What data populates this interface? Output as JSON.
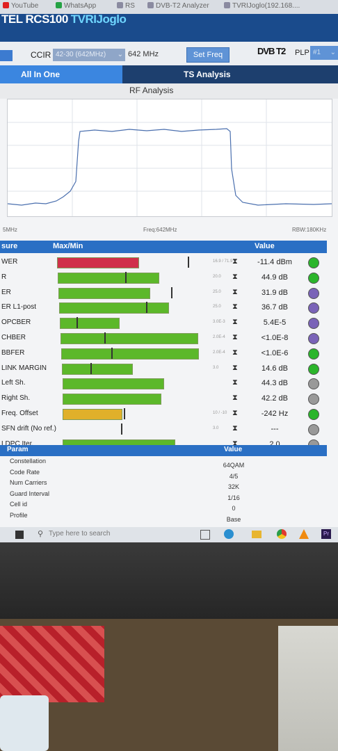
{
  "browser_tabs": [
    {
      "label": "YouTube",
      "color": "#e02020"
    },
    {
      "label": "WhatsApp",
      "color": "#25a244"
    },
    {
      "label": "RS",
      "color": "#8a8aa0"
    },
    {
      "label": "DVB-T2 Analyzer",
      "color": "#8a8aa0"
    },
    {
      "label": "TVRIJoglo(192.168....",
      "color": "#8a8aa0"
    }
  ],
  "app": {
    "brand": "TEL RCS100",
    "site": "TVRIJoglo",
    "ccir_label": "CCIR",
    "channel_value": "42-30 (642MHz)",
    "freq_text": "642 MHz",
    "set_freq": "Set Freq",
    "standard": "DVB T2",
    "plp_label": "PLP",
    "plp_value": "#1",
    "tab_allinone": "All In One",
    "tab_ts": "TS Analysis",
    "section_rf": "RF Analysis",
    "axis_center": "Freq:642MHz",
    "axis_left": "5MHz",
    "rbw": "RBW:180KHz"
  },
  "table": {
    "col_measure": "sure",
    "col_maxmin": "Max/Min",
    "col_value": "Value",
    "rows": [
      {
        "label": "WER",
        "thr": "16.9 / 71.9",
        "value": "-11.4 dBm",
        "bar_color": "#d0304a",
        "fill": 0.58,
        "mark": 0.9,
        "led": "#2bb52b"
      },
      {
        "label": "R",
        "thr": "20.0",
        "value": "44.9 dB",
        "bar_color": "#5cb82a",
        "fill": 0.72,
        "mark": 0.45,
        "led": "#2bb52b"
      },
      {
        "label": "ER",
        "thr": "25.0",
        "value": "31.9 dB",
        "bar_color": "#5cb82a",
        "fill": 0.65,
        "mark": 0.78,
        "led": "#7a63b8"
      },
      {
        "label": "ER L1-post",
        "thr": "25.0",
        "value": "36.7 dB",
        "bar_color": "#5cb82a",
        "fill": 0.78,
        "mark": 0.6,
        "led": "#7a63b8"
      },
      {
        "label": "OPCBER",
        "thr": "3.0E-3",
        "value": "5.4E-5",
        "bar_color": "#5cb82a",
        "fill": 0.42,
        "mark": 0.1,
        "led": "#7a63b8"
      },
      {
        "label": "CHBER",
        "thr": "2.0E-4",
        "value": "<1.0E-8",
        "bar_color": "#5cb82a",
        "fill": 0.98,
        "mark": 0.3,
        "led": "#7a63b8"
      },
      {
        "label": "BBFER",
        "thr": "2.0E-4",
        "value": "<1.0E-6",
        "bar_color": "#5cb82a",
        "fill": 0.98,
        "mark": 0.35,
        "led": "#2bb52b"
      },
      {
        "label": "LINK MARGIN",
        "thr": "3.0",
        "value": "14.6 dB",
        "bar_color": "#5cb82a",
        "fill": 0.5,
        "mark": 0.2,
        "led": "#2bb52b"
      },
      {
        "label": "Left Sh.",
        "thr": "",
        "value": "44.3 dB",
        "bar_color": "#5cb82a",
        "fill": 0.72,
        "mark": -1,
        "led": "#999999"
      },
      {
        "label": "Right Sh.",
        "thr": "",
        "value": "42.2 dB",
        "bar_color": "#5cb82a",
        "fill": 0.7,
        "mark": -1,
        "led": "#999999"
      },
      {
        "label": "Freq. Offset",
        "thr": "10 / -10",
        "value": "-242 Hz",
        "bar_color": "#e0b02a",
        "fill": 0.42,
        "mark": 0.44,
        "led": "#2bb52b"
      },
      {
        "label": "SFN drift (No ref.)",
        "thr": "3.0",
        "value": "---",
        "bar_color": "none",
        "fill": 0,
        "mark": 0.42,
        "led": "#999999"
      },
      {
        "label": "LDPC Iter.",
        "thr": "",
        "value": "2.0",
        "bar_color": "#5cb82a",
        "fill": 0.8,
        "mark": -1,
        "led": "#999999"
      }
    ]
  },
  "params": {
    "col_param": "Param",
    "col_value": "Value",
    "rows": [
      {
        "label": "Constellation",
        "value": "64QAM"
      },
      {
        "label": "Code Rate",
        "value": "4/5"
      },
      {
        "label": "Num Carriers",
        "value": "32K"
      },
      {
        "label": "Guard Interval",
        "value": "1/16"
      },
      {
        "label": "Cell id",
        "value": "0"
      },
      {
        "label": "Profile",
        "value": "Base"
      }
    ]
  },
  "taskbar": {
    "search_placeholder": "Type here to search"
  }
}
